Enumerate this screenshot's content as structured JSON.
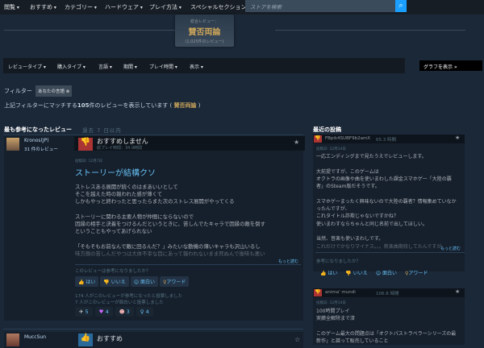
{
  "nav": {
    "items": [
      "閲覧",
      "おすすめ",
      "カテゴリー",
      "ハードウェア",
      "プレイ方法",
      "スペシャルセクション"
    ],
    "search_placeholder": "ストアを検索"
  },
  "summary": {
    "label": "総合レビュー：",
    "rating": "賛否両論",
    "count": "(1,025件のレビュー)"
  },
  "filters": {
    "items": [
      "レビュータイプ",
      "購入タイプ",
      "言語",
      "期間",
      "プレイ時間",
      "表示"
    ],
    "graph_button": "グラフを表示",
    "filter_label": "フィルター",
    "active_filter": "あなたの言語",
    "result_prefix": "上記フィルターにマッチする",
    "result_count": "105",
    "result_suffix": "件のレビューを表示しています (",
    "result_rating": "賛否両論",
    "result_close": ")"
  },
  "helpful": {
    "title": "最も参考になったレビュー",
    "period": "過去 7 日以内",
    "reviews": [
      {
        "author": "Kronos(JP)",
        "author_reviews": "31 件のレビュー",
        "verdict": "おすすめしません",
        "playtime": "総プレイ時間：34.9時間",
        "posted": "投稿日: 12月7日",
        "title": "ストーリーが結構クソ",
        "lines": [
          "ストレスある展開が続くのはまあいいとして",
          "そこを越えた時の報われた感が薄くて",
          "しかもやっと終わったと思ったらまた次のストレス展開がやってくる",
          "",
          "ストーリーに関わる主要人物が仲間にならないので",
          "因縁の相手と決着をつけるんだというときに、苦しんでたキャラで因縁の敵を倒す",
          "ということもやってあげられない",
          "",
          "「そもそもお前なんで敵に回るんだ？」みたいな動機の薄いキャラも沢山いるし",
          "味方側の苦しんだやつは大体不幸な目にあって報われないまま死ぬんで後味も悪い"
        ],
        "read_more": "もっと読む",
        "question": "このレビューは参考になりましたか？",
        "buttons": [
          "はい",
          "いいえ",
          "面白い",
          "アワード"
        ],
        "votes_helpful": "174 人がこのレビューが参考になったと投票しました",
        "votes_funny": "7 人がこのレビューが面白いと投票しました",
        "awards": [
          "5",
          "4",
          "3",
          "4"
        ]
      },
      {
        "author": "MuccSun",
        "verdict": "おすすめ"
      }
    ]
  },
  "recent": {
    "title": "最近の投稿",
    "posts": [
      {
        "author": "FBpik4SUBF9b2amX",
        "hours": "65.3 時間",
        "posted": "投稿日: 12月14日",
        "lines": [
          "一応エンディングまで見たうえでレビューします。",
          "",
          "大前提ですが、このゲームは",
          "オクトラの画像や曲を使いまわした課金スマホゲー「大陸の覇",
          "者」のSteam版だそうです。",
          "",
          "スマホゲーまったく興味ないので大陸の覇者？情報集めていなか",
          "ったんですが、",
          "これタイトル詐欺じゃないですかね？",
          "使いまわすならちゃんと同じ名前で出してほしい。",
          "",
          "当然、音楽も使いまわしです。",
          "これだけでかなりマイナス。。。新楽曲期待してたんですが。"
        ],
        "read_more": "もっと読む",
        "question": "参考になりましたか？",
        "buttons": [
          "はい",
          "いいえ",
          "面白い",
          "アワード"
        ]
      },
      {
        "author": "anima' mundi",
        "hours": "106.8 時間",
        "posted": "投稿日: 12月14日",
        "lines": [
          "100時間プレイ",
          "実績全解除まで済",
          "",
          "このゲーム最大の問題点は「オクトパストラベラーシリーズの最",
          "新作」と謳って販売していること"
        ]
      }
    ]
  }
}
